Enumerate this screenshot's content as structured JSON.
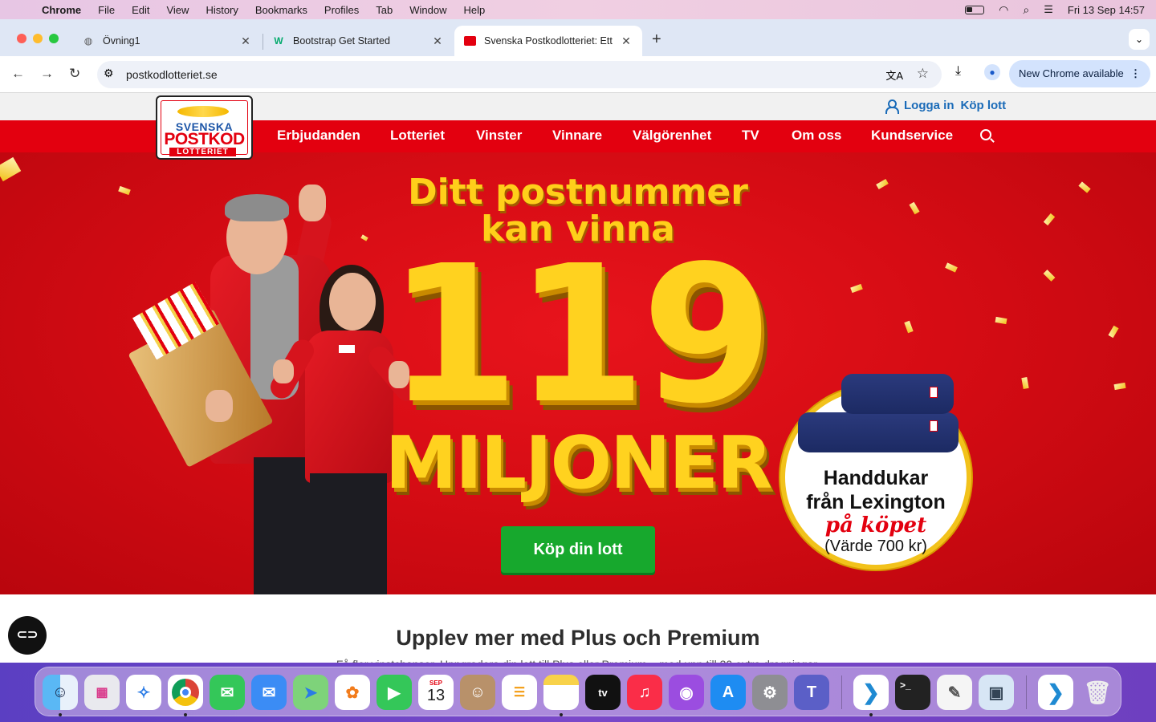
{
  "menubar": {
    "app": "Chrome",
    "items": [
      "File",
      "Edit",
      "View",
      "History",
      "Bookmarks",
      "Profiles",
      "Tab",
      "Window",
      "Help"
    ],
    "datetime": "Fri 13 Sep  14:57"
  },
  "tabs": [
    {
      "title": "Övning1",
      "icon": "globe-icon"
    },
    {
      "title": "Bootstrap Get Started",
      "icon": "w3schools-icon"
    },
    {
      "title": "Svenska Postkodlotteriet: Ett",
      "icon": "postkod-favicon"
    }
  ],
  "toolbar": {
    "url": "postkodlotteriet.se",
    "new_chrome": "New Chrome available"
  },
  "site": {
    "logo": {
      "line1": "SVENSKA",
      "line2": "POSTKOD",
      "line3": "LOTTERIET"
    },
    "account": {
      "login": "Logga in",
      "buy": "Köp lott"
    },
    "nav": [
      "Erbjudanden",
      "Lotteriet",
      "Vinster",
      "Vinnare",
      "Välgörenhet",
      "TV",
      "Om oss",
      "Kundservice"
    ],
    "hero": {
      "line1": "Ditt postnummer",
      "line2": "kan vinna",
      "amount": "119",
      "unit": "MILJONER",
      "cta": "Köp din lott"
    },
    "badge": {
      "line1": "Handdukar",
      "line2": "från Lexington",
      "line3": "på köpet",
      "line4": "(Värde 700 kr)"
    },
    "section_title": "Upplev mer med Plus och Premium",
    "section_sub": "Få fler vinstchanser. Uppgradera din lott till Plus eller Premium – med upp till 30 extra dragningar."
  },
  "dock": [
    "Finder",
    "Launchpad",
    "Safari",
    "Chrome",
    "Messages",
    "Mail",
    "Maps",
    "Photos",
    "FaceTime",
    "Calendar",
    "Contacts",
    "Reminders",
    "Notes",
    "Apple TV",
    "Music",
    "Podcasts",
    "App Store",
    "System Settings",
    "Teams",
    "Visual Studio Code",
    "Terminal",
    "TextEdit",
    "Preview",
    "Visual Studio Code",
    "Trash"
  ],
  "calendar": {
    "month": "SEP",
    "day": "13"
  },
  "colors": {
    "brand_red": "#e3000f",
    "cta_green": "#17a82d",
    "gold": "#ffd21f",
    "link_blue": "#1a6bb8"
  }
}
